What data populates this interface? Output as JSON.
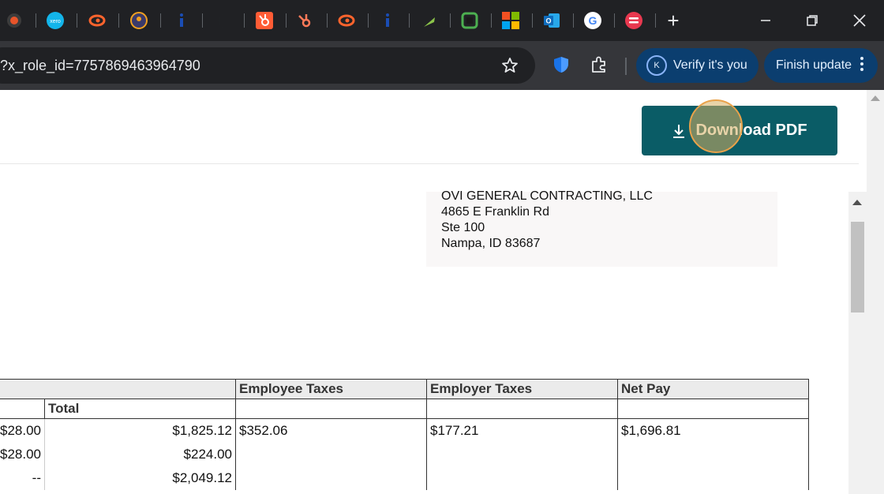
{
  "browser": {
    "tabs": [
      {
        "icon": "record-icon"
      },
      {
        "icon": "xero-icon"
      },
      {
        "icon": "semrush-icon"
      },
      {
        "icon": "profile-icon"
      },
      {
        "icon": "info-icon"
      },
      {
        "icon": "crescent-icon"
      },
      {
        "icon": "hubspot-icon"
      },
      {
        "icon": "hubspot-sprocket-icon"
      },
      {
        "icon": "semrush-icon"
      },
      {
        "icon": "info-icon"
      },
      {
        "icon": "leaf-icon"
      },
      {
        "icon": "square-app-icon"
      },
      {
        "icon": "microsoft-icon"
      },
      {
        "icon": "outlook-icon"
      },
      {
        "icon": "google-icon"
      },
      {
        "icon": "red-app-icon"
      }
    ],
    "new_tab_label": "+",
    "url": "?x_role_id=7757869463964790",
    "verify_label": "Verify it's you",
    "verify_avatar": "K",
    "update_label": "Finish update"
  },
  "page": {
    "download_label": "Download PDF",
    "address": {
      "line1": "OVI GENERAL CONTRACTING, LLC",
      "line2": "4865 E Franklin Rd",
      "line3": "Ste 100",
      "line4": "Nampa, ID 83687"
    },
    "table": {
      "headers": {
        "employee_taxes": "Employee Taxes",
        "employer_taxes": "Employer Taxes",
        "net_pay": "Net Pay"
      },
      "subheader_total": "Total",
      "rows": [
        {
          "prev": "$28.00",
          "total": "$1,825.12",
          "employee_taxes": "$352.06",
          "employer_taxes": "$177.21",
          "net_pay": "$1,696.81"
        },
        {
          "prev": "$28.00",
          "total": "$224.00",
          "employee_taxes": "",
          "employer_taxes": "",
          "net_pay": ""
        },
        {
          "prev": "--",
          "total": "$2,049.12",
          "employee_taxes": "",
          "employer_taxes": "",
          "net_pay": ""
        }
      ]
    }
  }
}
